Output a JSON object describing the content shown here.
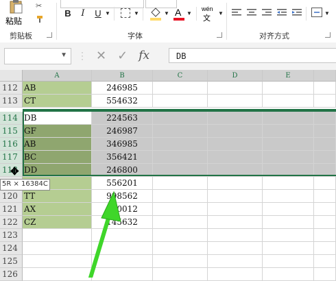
{
  "ribbon": {
    "paste_label": "粘贴",
    "clipboard_label": "剪贴板",
    "font_group_label": "字体",
    "align_group_label": "对齐方式",
    "bold": "B",
    "italic": "I",
    "underline": "U",
    "font_color_glyph": "A",
    "wen_glyph": "wén",
    "wen_sub": "文",
    "colors": {
      "fill": "#ffd966",
      "font": "#e81123",
      "selection": "#217346"
    }
  },
  "formula_bar": {
    "name_box_value": "",
    "cancel_icon": "✕",
    "enter_icon": "✓",
    "fx_label": "fx",
    "content": "DB"
  },
  "sheet": {
    "columns": [
      "A",
      "B",
      "C",
      "D",
      "E"
    ],
    "rows": [
      {
        "num": "112",
        "a": "AB",
        "b": "246985"
      },
      {
        "num": "113",
        "a": "CT",
        "b": "554632"
      },
      {
        "num": "114",
        "a": "DB",
        "b": "224563"
      },
      {
        "num": "115",
        "a": "GF",
        "b": "246987"
      },
      {
        "num": "116",
        "a": "AB",
        "b": "346985"
      },
      {
        "num": "117",
        "a": "BC",
        "b": "356421"
      },
      {
        "num": "118",
        "a": "DD",
        "b": "246800"
      },
      {
        "num": "119",
        "a": "",
        "b": "556201"
      },
      {
        "num": "120",
        "a": "TT",
        "b": "998562"
      },
      {
        "num": "121",
        "a": "AX",
        "b": "100012"
      },
      {
        "num": "122",
        "a": "CZ",
        "b": "145632"
      },
      {
        "num": "123",
        "a": "",
        "b": ""
      },
      {
        "num": "124",
        "a": "",
        "b": ""
      },
      {
        "num": "125",
        "a": "",
        "b": ""
      },
      {
        "num": "126",
        "a": "",
        "b": ""
      }
    ],
    "selection_tooltip": "5R × 16384C"
  }
}
